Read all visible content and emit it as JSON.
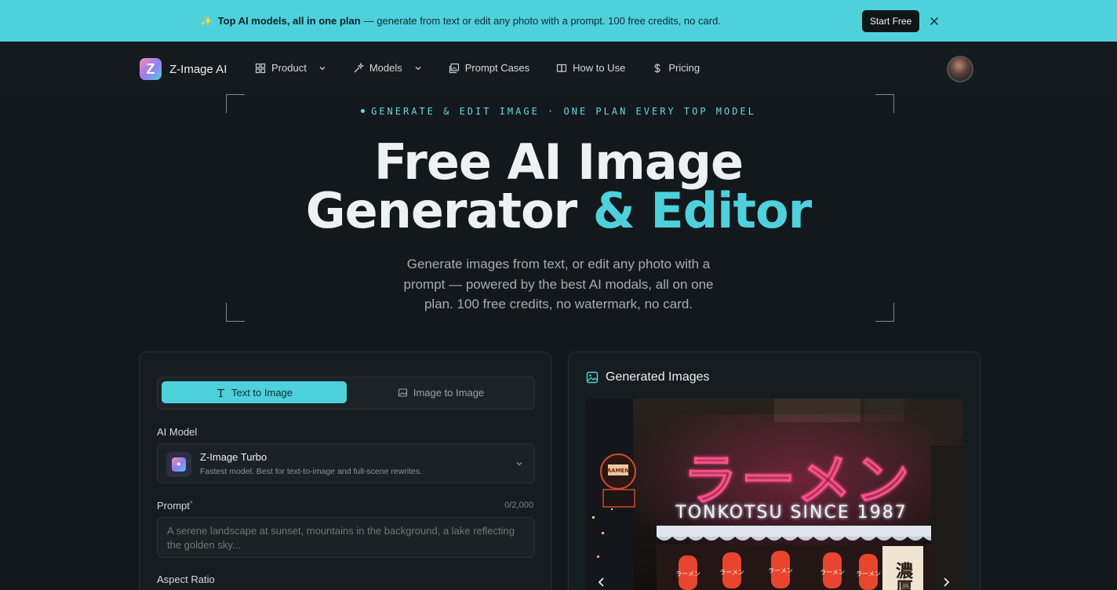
{
  "colors": {
    "accent": "#4fd1dc",
    "background": "#12181c",
    "panel": "#161d21"
  },
  "banner": {
    "icon": "sparkles-icon",
    "bold_text": "Top AI models, all in one plan",
    "text": "— generate from text or edit any photo with a prompt. 100 free credits, no card.",
    "cta_label": "Start Free"
  },
  "nav": {
    "logo_letter": "Z",
    "brand": "Z-Image AI",
    "items": [
      {
        "label": "Product",
        "icon": "grid-icon",
        "has_dropdown": true
      },
      {
        "label": "Models",
        "icon": "sparkle-wand-icon",
        "has_dropdown": true
      },
      {
        "label": "Prompt Cases",
        "icon": "gallery-icon",
        "has_dropdown": false
      },
      {
        "label": "How to Use",
        "icon": "book-icon",
        "has_dropdown": false
      },
      {
        "label": "Pricing",
        "icon": "dollar-icon",
        "has_dropdown": false
      }
    ]
  },
  "hero": {
    "eyebrow": "GENERATE & EDIT IMAGE · ONE PLAN EVERY TOP MODEL",
    "title_line1": "Free AI Image",
    "title_line2_plain": "Generator ",
    "title_line2_accent": "& Editor",
    "subtitle": "Generate images from text, or edit any photo with a prompt — powered by the best AI modals, all on one plan. 100 free credits, no watermark, no card."
  },
  "generator": {
    "tabs": [
      {
        "label": "Text to Image",
        "active": true
      },
      {
        "label": "Image to Image",
        "active": false
      }
    ],
    "model_label": "AI Model",
    "model": {
      "name": "Z-Image Turbo",
      "description": "Fastest model. Best for text-to-image and full-scene rewrites."
    },
    "prompt_label": "Prompt",
    "prompt_required_mark": "*",
    "prompt_counter": "0/2,000",
    "prompt_placeholder": "A serene landscape at sunset, mountains in the background, a lake reflecting the golden sky...",
    "aspect_label": "Aspect Ratio"
  },
  "gallery": {
    "title": "Generated Images",
    "image": {
      "neon_text": "ラーメン",
      "sign_text": "TONKOTSU SINCE 1987",
      "small_sign_text": "RAMEN",
      "side_kanji": "濃厚",
      "lantern_text": "ラーメン"
    }
  }
}
